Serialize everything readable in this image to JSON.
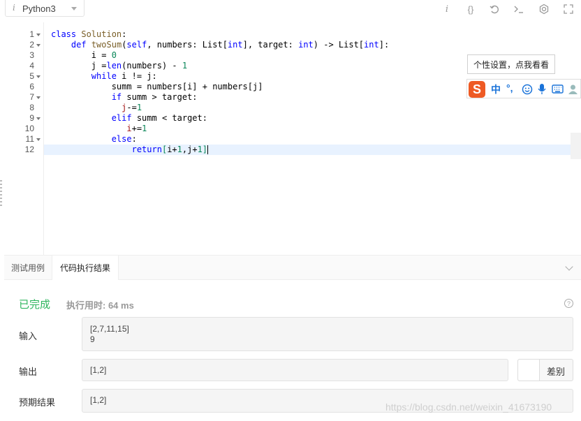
{
  "toolbar": {
    "language": "Python3",
    "icons": [
      "info-icon",
      "braces-icon",
      "reset-icon",
      "terminal-icon",
      "settings-icon",
      "fullscreen-icon"
    ]
  },
  "editor": {
    "line_numbers": [
      "1",
      "2",
      "3",
      "4",
      "5",
      "6",
      "7",
      "8",
      "9",
      "10",
      "11",
      "12"
    ],
    "fold_lines": [
      1,
      2,
      5,
      7,
      9,
      11
    ],
    "lines": [
      "class Solution:",
      "    def twoSum(self, numbers: List[int], target: int) -> List[int]:",
      "        i = 0",
      "        j =len(numbers) - 1",
      "        while i != j:",
      "            summ = numbers[i] + numbers[j]",
      "            if summ > target:",
      "              j-=1",
      "            elif summ < target:",
      "               i+=1",
      "            else:",
      "                return[i+1,j+1]"
    ]
  },
  "ime": {
    "tip": "个性设置，点我看看",
    "logo": "S",
    "mode": "中",
    "punct": "°,",
    "colors": {
      "logo": "#ee5a24",
      "items": "#1a73d9"
    }
  },
  "panel": {
    "tabs": [
      {
        "label": "测试用例",
        "active": false
      },
      {
        "label": "代码执行结果",
        "active": true
      }
    ],
    "status": "已完成",
    "time_label": "执行用时: 64 ms",
    "input_label": "输入",
    "input_lines": [
      "[2,7,11,15]",
      "9"
    ],
    "output_label": "输出",
    "output_value": "[1,2]",
    "diff_label": "差别",
    "expected_label": "预期结果",
    "expected_value": "[1,2]"
  },
  "watermark": "https://blog.csdn.net/weixin_41673190",
  "colors": {
    "success": "#2db55d",
    "active_line": "#e8f2ff"
  }
}
